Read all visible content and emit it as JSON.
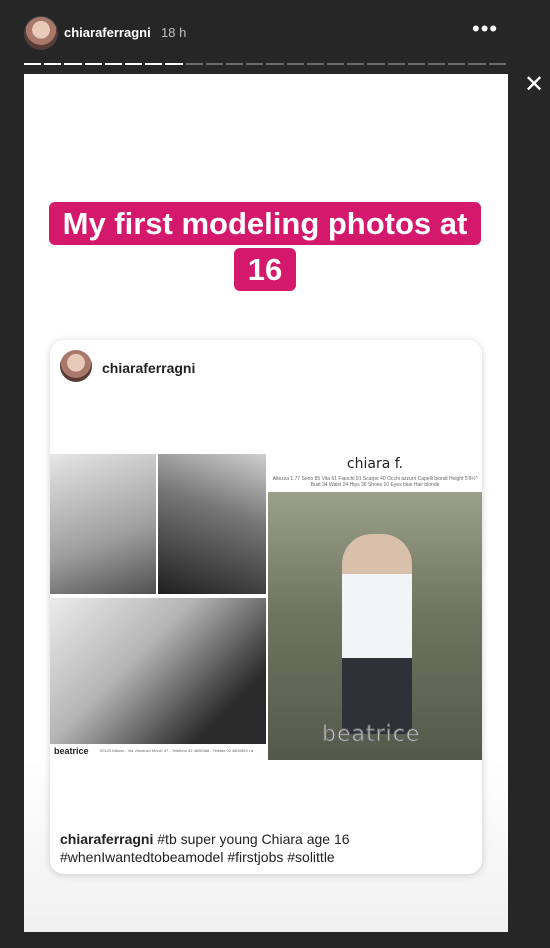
{
  "header": {
    "username": "chiaraferragni",
    "time": "18 h",
    "more_icon": "•••",
    "close_icon": "✕"
  },
  "progress": {
    "segments_total": 24,
    "segments_viewed": 8
  },
  "story": {
    "headline": "My first modeling photos at 16",
    "colors": {
      "highlight": "#d4196d",
      "text": "#ffffff"
    },
    "post": {
      "username": "chiaraferragni",
      "comp_card": {
        "model_name": "chiara f.",
        "agency": "beatrice",
        "agency_stats": "Altezza 1.77 Seno 85 Vita 61 Fianchi 91 Scarpe 40 Occhi azzurri Capelli biondi Height 5'9½\" Bust 34 Waist 24 Hips 36 Shoes 10 Eyes blue Hair blonde",
        "agency_address": "20123 Milano - Via Vincenzo Monti, 47 - Telefono 02 4800588 - Telefax 02 4800593 r.a."
      },
      "caption_username": "chiaraferragni",
      "caption_text": "#tb super young Chiara age 16 #whenIwantedtobeamodel #firstjobs #solittle"
    }
  }
}
